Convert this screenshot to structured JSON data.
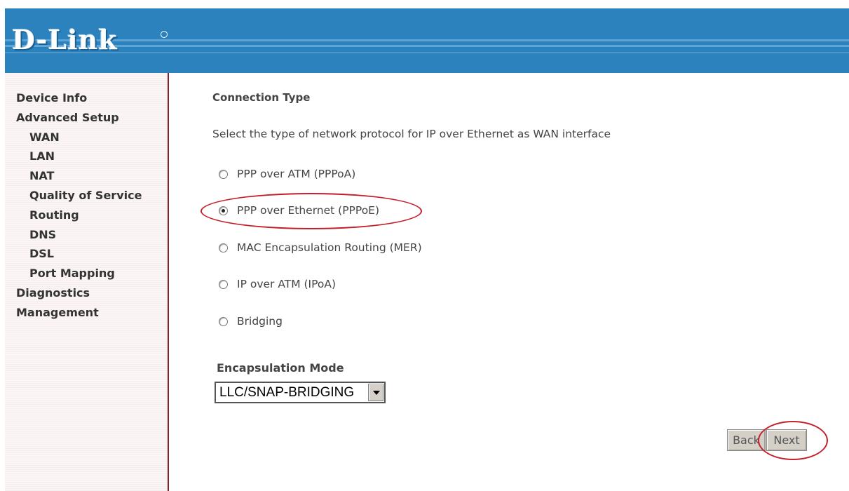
{
  "header": {
    "logo_text": "D-Link",
    "color": "#2b82bd"
  },
  "sidebar": {
    "items": [
      {
        "label": "Device Info"
      },
      {
        "label": "Advanced Setup"
      },
      {
        "label": "WAN"
      },
      {
        "label": "LAN"
      },
      {
        "label": "NAT"
      },
      {
        "label": "Quality of Service"
      },
      {
        "label": "Routing"
      },
      {
        "label": "DNS"
      },
      {
        "label": "DSL"
      },
      {
        "label": "Port Mapping"
      },
      {
        "label": "Diagnostics"
      },
      {
        "label": "Management"
      }
    ]
  },
  "main": {
    "title": "Connection Type",
    "instruction": "Select the type of network protocol for IP over Ethernet as WAN interface",
    "options": [
      {
        "label": "PPP over ATM (PPPoA)",
        "checked": false
      },
      {
        "label": "PPP over Ethernet (PPPoE)",
        "checked": true
      },
      {
        "label": "MAC Encapsulation Routing (MER)",
        "checked": false
      },
      {
        "label": "IP over ATM (IPoA)",
        "checked": false
      },
      {
        "label": "Bridging",
        "checked": false
      }
    ],
    "encapsulation": {
      "label": "Encapsulation Mode",
      "value": "LLC/SNAP-BRIDGING"
    },
    "buttons": {
      "back": "Back",
      "next": "Next"
    },
    "highlight_color": "#c4202a"
  }
}
